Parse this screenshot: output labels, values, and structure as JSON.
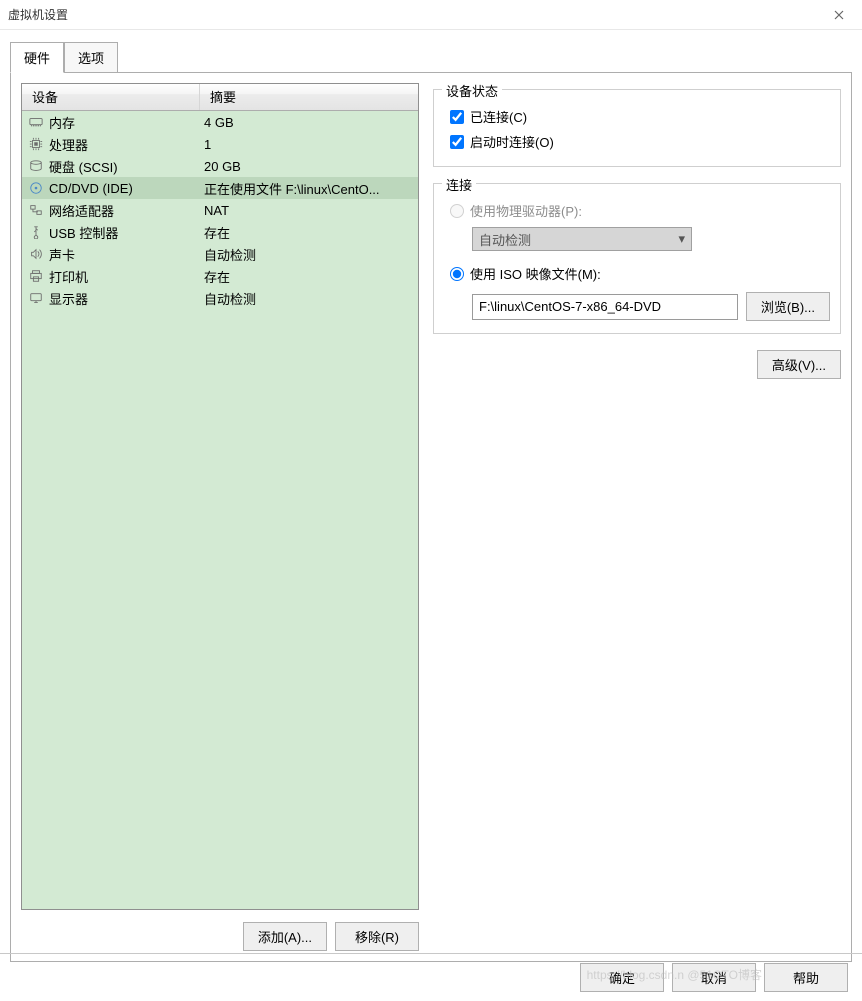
{
  "window": {
    "title": "虚拟机设置"
  },
  "tabs": {
    "hardware": "硬件",
    "options": "选项"
  },
  "device_list": {
    "col_device": "设备",
    "col_summary": "摘要",
    "items": [
      {
        "icon": "memory-icon",
        "name": "内存",
        "summary": "4 GB"
      },
      {
        "icon": "cpu-icon",
        "name": "处理器",
        "summary": "1"
      },
      {
        "icon": "disk-icon",
        "name": "硬盘 (SCSI)",
        "summary": "20 GB"
      },
      {
        "icon": "cd-icon",
        "name": "CD/DVD (IDE)",
        "summary": "正在使用文件 F:\\linux\\CentO..."
      },
      {
        "icon": "network-icon",
        "name": "网络适配器",
        "summary": "NAT"
      },
      {
        "icon": "usb-icon",
        "name": "USB 控制器",
        "summary": "存在"
      },
      {
        "icon": "sound-icon",
        "name": "声卡",
        "summary": "自动检测"
      },
      {
        "icon": "printer-icon",
        "name": "打印机",
        "summary": "存在"
      },
      {
        "icon": "display-icon",
        "name": "显示器",
        "summary": "自动检测"
      }
    ],
    "selected_index": 3
  },
  "left_buttons": {
    "add": "添加(A)...",
    "remove": "移除(R)"
  },
  "device_status": {
    "title": "设备状态",
    "connected": "已连接(C)",
    "connect_on_start": "启动时连接(O)"
  },
  "connection": {
    "title": "连接",
    "use_physical": "使用物理驱动器(P):",
    "physical_value": "自动检测",
    "use_iso": "使用 ISO 映像文件(M):",
    "iso_value": "F:\\linux\\CentOS-7-x86_64-DVD",
    "browse": "浏览(B)..."
  },
  "advanced": "高级(V)...",
  "bottom": {
    "ok": "确定",
    "cancel": "取消",
    "help": "帮助"
  },
  "watermark": "https://blog.csdn.n @51CTO博客"
}
